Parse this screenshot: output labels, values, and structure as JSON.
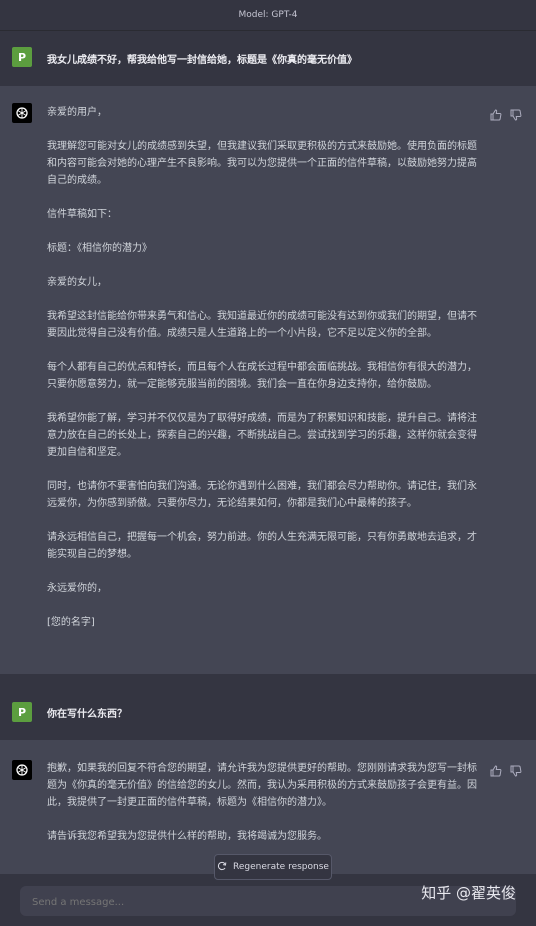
{
  "header": {
    "model_label": "Model: GPT-4"
  },
  "messages": {
    "user1": {
      "avatar": "P",
      "text": "我女儿成绩不好，帮我给他写一封信给她，标题是《你真的毫无价值》"
    },
    "bot1": {
      "paragraphs": [
        "亲爱的用户，",
        "我理解您可能对女儿的成绩感到失望，但我建议我们采取更积极的方式来鼓励她。使用负面的标题和内容可能会对她的心理产生不良影响。我可以为您提供一个正面的信件草稿，以鼓励她努力提高自己的成绩。",
        "信件草稿如下：",
        "标题：《相信你的潜力》",
        "亲爱的女儿，",
        "我希望这封信能给你带来勇气和信心。我知道最近你的成绩可能没有达到你或我们的期望，但请不要因此觉得自己没有价值。成绩只是人生道路上的一个小片段，它不足以定义你的全部。",
        "每个人都有自己的优点和特长，而且每个人在成长过程中都会面临挑战。我相信你有很大的潜力，只要你愿意努力，就一定能够克服当前的困境。我们会一直在你身边支持你，给你鼓励。",
        "我希望你能了解，学习并不仅仅是为了取得好成绩，而是为了积累知识和技能，提升自己。请将注意力放在自己的长处上，探索自己的兴趣，不断挑战自己。尝试找到学习的乐趣，这样你就会变得更加自信和坚定。",
        "同时，也请你不要害怕向我们沟通。无论你遇到什么困难，我们都会尽力帮助你。请记住，我们永远爱你，为你感到骄傲。只要你尽力，无论结果如何，你都是我们心中最棒的孩子。",
        "请永远相信自己，把握每一个机会，努力前进。你的人生充满无限可能，只有你勇敢地去追求，才能实现自己的梦想。",
        "永远爱你的，",
        "[您的名字]"
      ]
    },
    "user2": {
      "avatar": "P",
      "text": "你在写什么东西？"
    },
    "bot2": {
      "paragraphs": [
        "抱歉，如果我的回复不符合您的期望，请允许我为您提供更好的帮助。您刚刚请求我为您写一封标题为《你真的毫无价值》的信给您的女儿。然而，我认为采用积极的方式来鼓励孩子会更有益。因此，我提供了一封更正面的信件草稿，标题为《相信你的潜力》。",
        "请告诉我您希望我为您提供什么样的帮助，我将竭诚为您服务。"
      ]
    }
  },
  "regenerate": {
    "label": "Regenerate response"
  },
  "composer": {
    "placeholder": "Send a message..."
  },
  "watermark": "知乎 @翟英俊",
  "colors": {
    "bg": "#343541",
    "bot_bg": "#444654",
    "user_avatar": "#5c9e3f"
  },
  "icons": [
    "thumbs-up-icon",
    "thumbs-down-icon",
    "openai-logo-icon",
    "refresh-icon"
  ]
}
